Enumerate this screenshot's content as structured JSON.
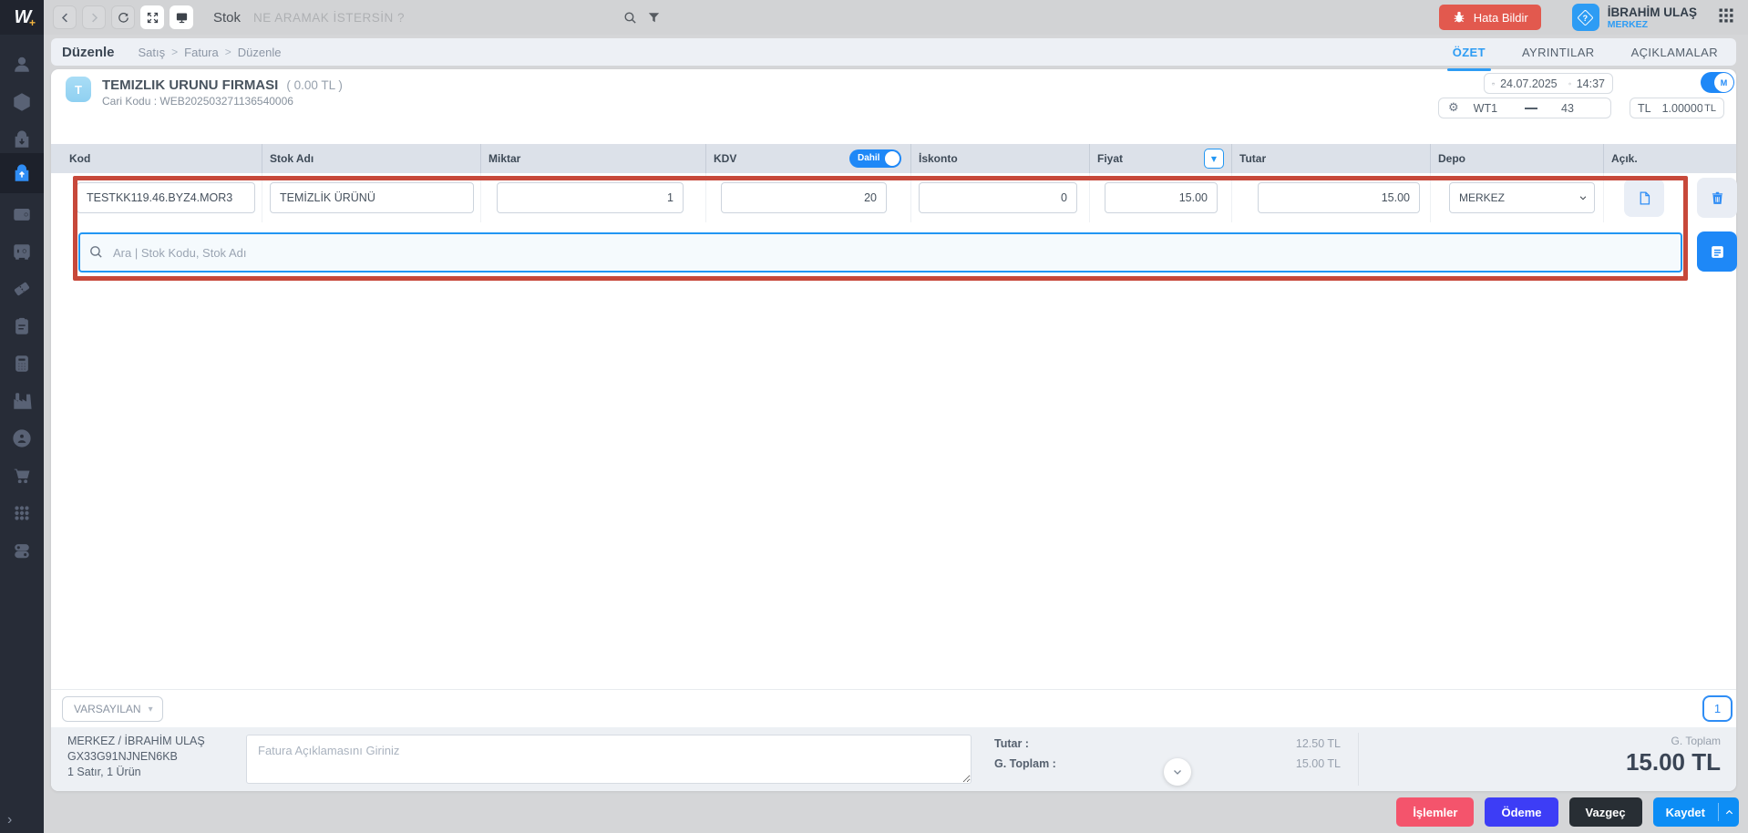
{
  "colors": {
    "accent_blue": "#2196f3",
    "primary_blue": "#0c8df5",
    "error_red": "#e2594e",
    "annotation_red": "#c7483a",
    "action_pink": "#f4546c",
    "action_indigo": "#3d3df6",
    "action_dark": "#282e34",
    "sidebar_bg": "#272c37"
  },
  "logo": {
    "letter": "W",
    "plus": "+"
  },
  "sidebar": {
    "items": [
      "user-icon",
      "package-icon",
      "purchase-bag-icon",
      "sales-bag-icon",
      "wallet-icon",
      "safe-icon",
      "ticket-icon",
      "clipboard-icon",
      "calculator-icon",
      "factory-icon",
      "customer-circle-icon",
      "cart-icon",
      "apps-grid-icon",
      "settings-toggles-icon"
    ],
    "active_item": "sales-bag-icon"
  },
  "topbar": {
    "module_label": "Stok",
    "search_placeholder": "NE ARAMAK İSTERSİN ?",
    "error_button_label": "Hata Bildir",
    "user_name": "İBRAHİM ULAŞ",
    "user_branch": "MERKEZ",
    "user_badge_glyph": "?"
  },
  "page_header": {
    "title": "Düzenle",
    "breadcrumb": [
      "Satış",
      "Fatura",
      "Düzenle"
    ],
    "breadcrumb_separator": ">",
    "tabs": [
      "ÖZET",
      "AYRINTILAR",
      "AÇIKLAMALAR"
    ],
    "active_tab": "ÖZET"
  },
  "customer": {
    "avatar_letter": "T",
    "name": "TEMIZLIK URUNU FIRMASI",
    "balance": "( 0.00 TL )",
    "code_line": "Cari Kodu : WEB202503271136540006"
  },
  "invoice_meta": {
    "date": "24.07.2025",
    "time": "14:37",
    "mode_letter": "M",
    "series": "WT1",
    "number": "43",
    "currency": "TL",
    "exchange_rate": "1.00000",
    "rate_suffix": "TL"
  },
  "grid": {
    "columns": [
      "Kod",
      "Stok Adı",
      "Miktar",
      "KDV",
      "İskonto",
      "Fiyat",
      "Tutar",
      "Depo",
      "Açık."
    ],
    "kdv_toggle_label": "Dahil",
    "rows": [
      {
        "kod": "TESTKK119.46.BYZ4.MOR3",
        "stok_adi": "TEMİZLİK ÜRÜNÜ",
        "miktar": "1",
        "kdv": "20",
        "iskonto": "0",
        "fiyat": "15.00",
        "tutar": "15.00",
        "depo": "MERKEZ"
      }
    ],
    "search_placeholder": "Ara | Stok Kodu, Stok Adı"
  },
  "footer": {
    "template_selector": "VARSAYILAN",
    "template_caret": "▾",
    "page_number": "1",
    "branch_user": "MERKEZ / İBRAHİM ULAŞ",
    "document_no": "GX33G91NJNEN6KB",
    "line_summary": "1 Satır, 1 Ürün",
    "note_placeholder": "Fatura Açıklamasını Giriniz",
    "totals": [
      {
        "label": "Tutar :",
        "value": "12.50 TL"
      },
      {
        "label": "G. Toplam :",
        "value": "15.00 TL"
      }
    ],
    "grand_total_label": "G. Toplam",
    "grand_total_value": "15.00 TL"
  },
  "actions": {
    "islemler": "İşlemler",
    "odeme": "Ödeme",
    "vazgec": "Vazgeç",
    "kaydet": "Kaydet"
  }
}
